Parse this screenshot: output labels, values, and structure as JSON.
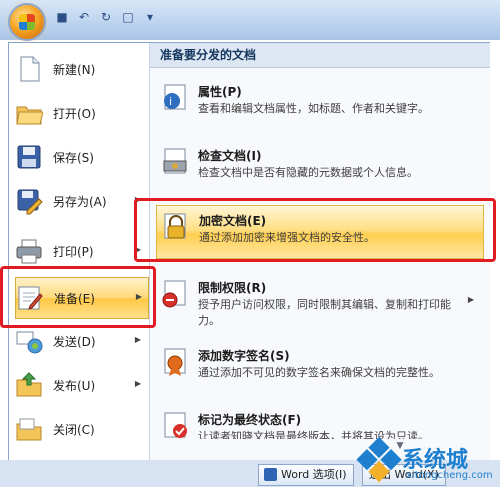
{
  "window": {
    "title": ""
  },
  "quick_access": {
    "save_icon": "save-icon",
    "undo_icon": "undo-icon",
    "redo_icon": "redo-icon",
    "new_icon": "new-doc-icon"
  },
  "left_menu": [
    {
      "label": "新建(N)",
      "icon": "new-document-icon",
      "has_submenu": false
    },
    {
      "label": "打开(O)",
      "icon": "open-folder-icon",
      "has_submenu": false
    },
    {
      "label": "保存(S)",
      "icon": "save-icon",
      "has_submenu": false
    },
    {
      "label": "另存为(A)",
      "icon": "save-as-icon",
      "has_submenu": true
    },
    {
      "label": "打印(P)",
      "icon": "printer-icon",
      "has_submenu": true
    },
    {
      "label": "准备(E)",
      "icon": "prepare-icon",
      "has_submenu": true,
      "active": true
    },
    {
      "label": "发送(D)",
      "icon": "send-icon",
      "has_submenu": true
    },
    {
      "label": "发布(U)",
      "icon": "publish-icon",
      "has_submenu": true
    },
    {
      "label": "关闭(C)",
      "icon": "close-folder-icon",
      "has_submenu": false
    }
  ],
  "right_panel": {
    "header": "准备要分发的文档",
    "items": [
      {
        "title": "属性(P)",
        "desc": "查看和编辑文档属性，如标题、作者和关键字。"
      },
      {
        "title": "检查文档(I)",
        "desc": "检查文档中是否有隐藏的元数据或个人信息。"
      },
      {
        "title": "加密文档(E)",
        "desc": "通过添加加密来增强文档的安全性。",
        "highlighted": true
      },
      {
        "title": "限制权限(R)",
        "desc": "授予用户访问权限，同时限制其编辑、复制和打印能力。",
        "has_submenu": true
      },
      {
        "title": "添加数字签名(S)",
        "desc": "通过添加不可见的数字签名来确保文档的完整性。"
      },
      {
        "title": "标记为最终状态(F)",
        "desc": "让读者知晓文档是最终版本，并将其设为只读。"
      }
    ]
  },
  "bottom_bar": {
    "word_options": "Word 选项(I)",
    "exit": "退出 Word(X)"
  },
  "watermark": {
    "name": "系统城",
    "url": "xitongcheng.com"
  },
  "colors": {
    "highlight": "#ffd66b",
    "annotation_red": "#e11b22",
    "ribbon_blue": "#bcd3ee"
  }
}
